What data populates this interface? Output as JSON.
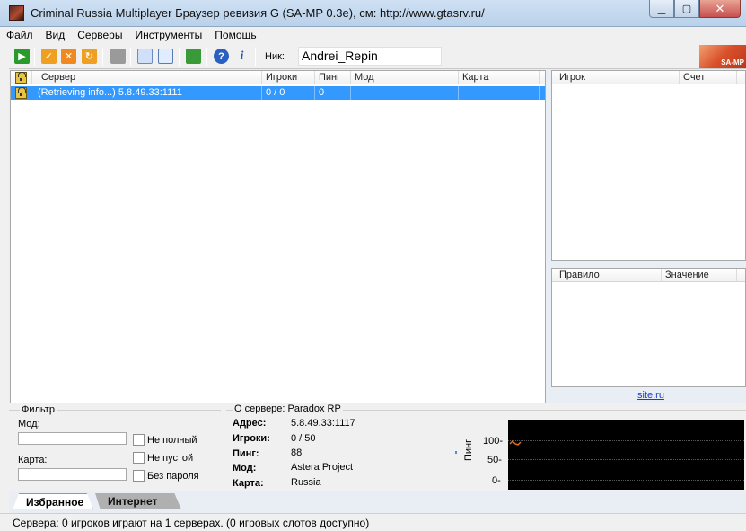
{
  "window": {
    "title": "Criminal Russia Multiplayer Браузер ревизия G (SA-MP 0.3e), см: http://www.gtasrv.ru/",
    "minimize": "▁",
    "maximize": "▢",
    "close": "✕"
  },
  "menu": [
    "Файл",
    "Вид",
    "Серверы",
    "Инструменты",
    "Помощь"
  ],
  "toolbar": {
    "nick_label": "Ник:",
    "nick_value": "Andrei_Repin",
    "logo_text": "SA-MP"
  },
  "server_list": {
    "columns": [
      "Сервер",
      "Игроки",
      "Пинг",
      "Мод",
      "Карта"
    ],
    "rows": [
      {
        "server": "(Retrieving info...) 5.8.49.33:1111",
        "players": "0 / 0",
        "ping": "0",
        "mod": "",
        "map": ""
      }
    ]
  },
  "players_panel": {
    "columns": [
      "Игрок",
      "Счет"
    ]
  },
  "rules_panel": {
    "columns": [
      "Правило",
      "Значение"
    ]
  },
  "site_link": "site.ru",
  "filter": {
    "title": "Фильтр",
    "mod_label": "Мод:",
    "map_label": "Карта:",
    "not_full": "Не полный",
    "not_empty": "Не пустой",
    "no_password": "Без пароля"
  },
  "server_info": {
    "title": "О сервере: Paradox RP",
    "address_label": "Адрес:",
    "address": "5.8.49.33:1117",
    "players_label": "Игроки:",
    "players": "0 / 50",
    "ping_label": "Пинг:",
    "ping": "88",
    "mode_label": "Мод:",
    "mode": "Astera Project",
    "map_label": "Карта:",
    "map": "Russia"
  },
  "ping_graph": {
    "axis_label": "Пинг",
    "ticks": [
      "100-",
      "50-",
      "0-"
    ]
  },
  "tabs": {
    "favorites": "Избранное",
    "internet": "Интернет"
  },
  "status": "Сервера: 0 игроков играют на 1 серверах. (0 игровых слотов доступно)"
}
